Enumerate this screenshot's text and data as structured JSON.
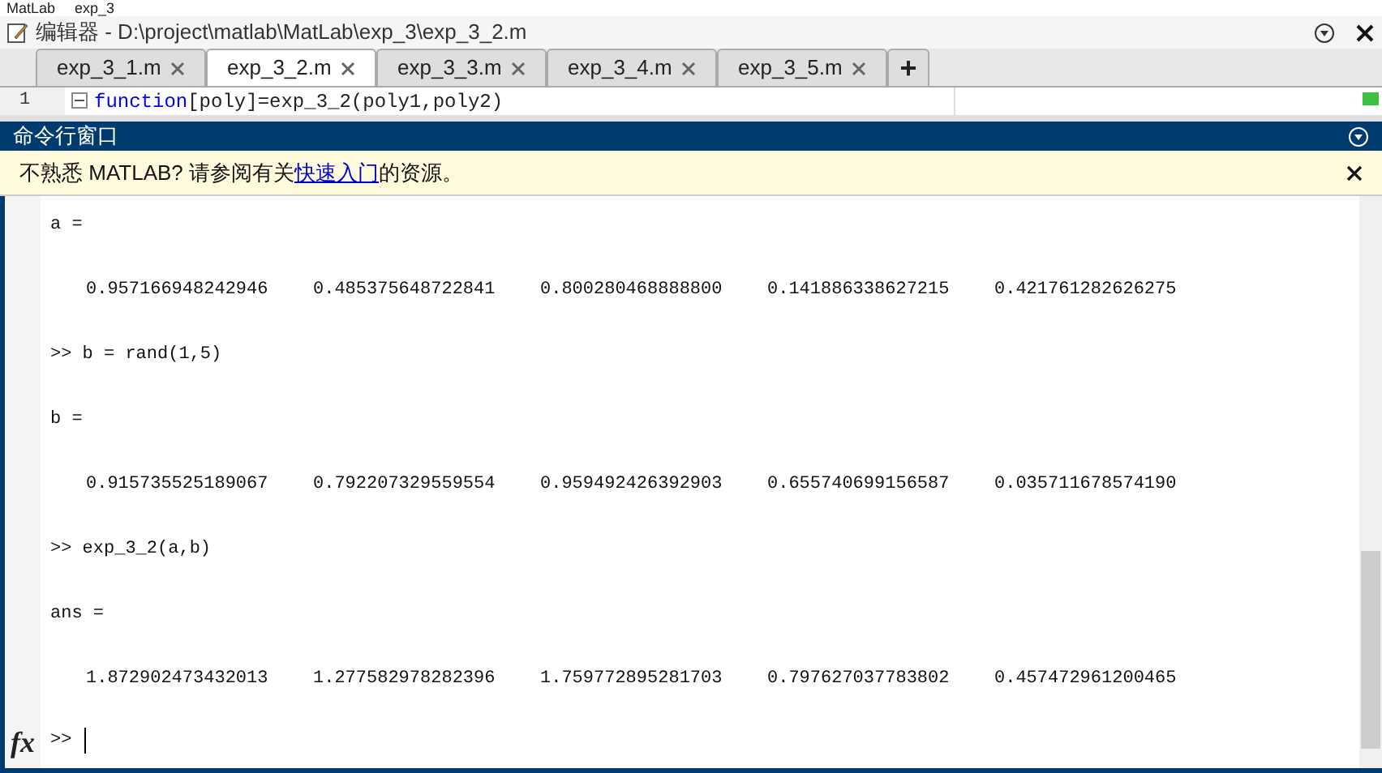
{
  "breadcrumb": [
    "MatLab",
    "exp_3"
  ],
  "editor": {
    "title": "编辑器 - D:\\project\\matlab\\MatLab\\exp_3\\exp_3_2.m",
    "tabs": [
      {
        "label": "exp_3_1.m",
        "selected": false
      },
      {
        "label": "exp_3_2.m",
        "selected": true
      },
      {
        "label": "exp_3_3.m",
        "selected": false
      },
      {
        "label": "exp_3_4.m",
        "selected": false
      },
      {
        "label": "exp_3_5.m",
        "selected": false
      }
    ],
    "add_tab": "+",
    "code_line": {
      "number": "1",
      "keyword": "function",
      "rest": "[poly]=exp_3_2(poly1,poly2)"
    }
  },
  "command_window": {
    "title": "命令行窗口",
    "notice": {
      "before": "不熟悉 MATLAB? 请参阅有关",
      "link": "快速入门",
      "after": "的资源。"
    },
    "lines": [
      {
        "kind": "text",
        "text": "a ="
      },
      {
        "kind": "values",
        "values": [
          "0.957166948242946",
          "0.485375648722841",
          "0.800280468888800",
          "0.141886338627215",
          "0.421761282626275"
        ]
      },
      {
        "kind": "text",
        "text": ">> b = rand(1,5)"
      },
      {
        "kind": "text",
        "text": "b ="
      },
      {
        "kind": "values",
        "values": [
          "0.915735525189067",
          "0.792207329559554",
          "0.959492426392903",
          "0.655740699156587",
          "0.035711678574190"
        ]
      },
      {
        "kind": "text",
        "text": ">> exp_3_2(a,b)"
      },
      {
        "kind": "text",
        "text": "ans ="
      },
      {
        "kind": "values",
        "values": [
          "1.872902473432013",
          "1.277582978282396",
          "1.759772895281703",
          "0.797627037783802",
          "0.457472961200465"
        ]
      }
    ],
    "prompt": ">>",
    "function_button": "fx"
  }
}
